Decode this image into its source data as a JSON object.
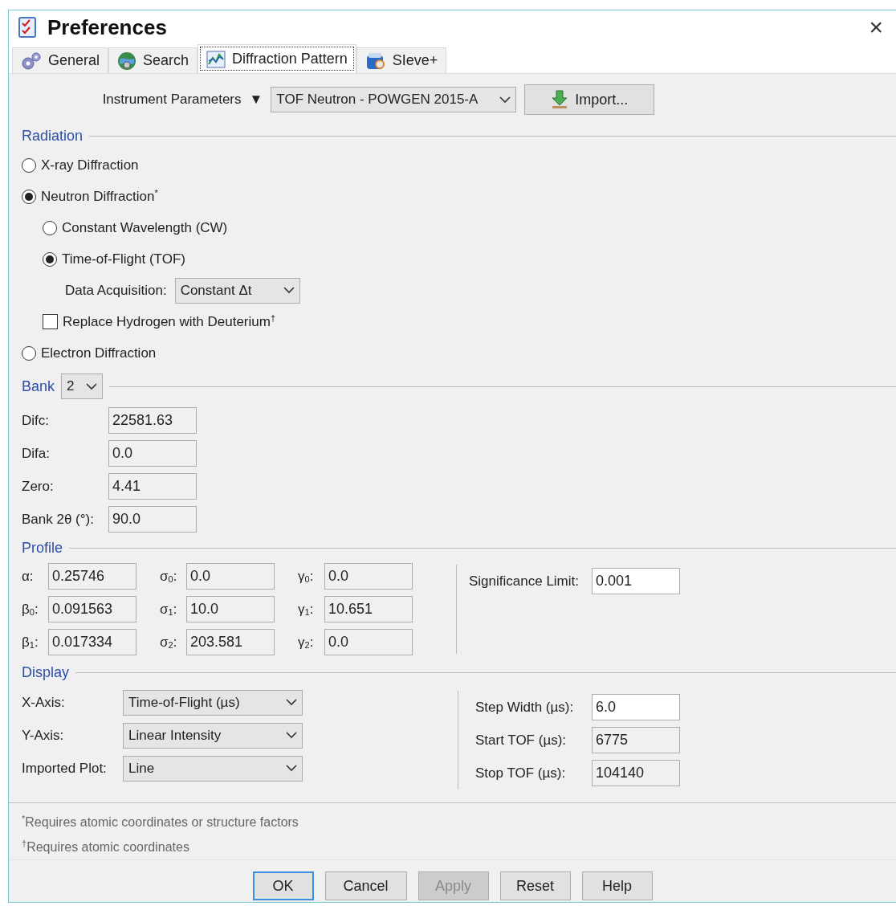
{
  "window": {
    "title": "Preferences",
    "close": "×"
  },
  "tabs": [
    {
      "label": "General",
      "selected": false
    },
    {
      "label": "Search",
      "selected": false
    },
    {
      "label": "Diffraction Pattern",
      "selected": true
    },
    {
      "label": "SIeve+",
      "selected": false
    }
  ],
  "instrument": {
    "menu_label": "Instrument Parameters",
    "menu_arrow": "▼",
    "preset": "TOF Neutron - POWGEN 2015-A",
    "import_button": "Import..."
  },
  "radiation": {
    "title": "Radiation",
    "options": [
      {
        "kind": "radio",
        "label": "X-ray Diffraction",
        "selected": false
      },
      {
        "kind": "radio",
        "label": "Neutron Diffraction$^{*}$",
        "selected": true,
        "children": [
          {
            "kind": "radio",
            "label": "Constant Wavelength (CW)",
            "selected": false
          },
          {
            "kind": "radio",
            "label": "Time-of-Flight (TOF)",
            "selected": true
          },
          {
            "kind": "select",
            "label": "Data Acquisition:",
            "value": "Constant Δt"
          },
          {
            "kind": "checkbox",
            "label": "Replace Hydrogen with Deuterium$^{†}$",
            "checked": false
          }
        ]
      },
      {
        "kind": "radio",
        "label": "Electron Diffraction",
        "selected": false
      }
    ]
  },
  "bank": {
    "title": "Bank",
    "value": "2",
    "fields": [
      {
        "label": "Difc:",
        "value": "22581.63",
        "editable": false
      },
      {
        "label": "Difa:",
        "value": "0.0",
        "editable": false
      },
      {
        "label": "Zero:",
        "value": "4.41",
        "editable": false
      },
      {
        "label": "Bank 2θ (°):",
        "value": "90.0",
        "editable": false
      }
    ]
  },
  "profile": {
    "title": "Profile",
    "columns": [
      [
        {
          "label": "α:",
          "value": "0.25746",
          "editable": false
        },
        {
          "label": "β$_{0}$:",
          "value": "0.091563",
          "editable": false
        },
        {
          "label": "β$_{1}$:",
          "value": "0.017334",
          "editable": false
        }
      ],
      [
        {
          "label": "σ$_{0}$:",
          "value": "0.0",
          "editable": false
        },
        {
          "label": "σ$_{1}$:",
          "value": "10.0",
          "editable": false
        },
        {
          "label": "σ$_{2}$:",
          "value": "203.581",
          "editable": false
        }
      ],
      [
        {
          "label": "γ$_{0}$:",
          "value": "0.0",
          "editable": false
        },
        {
          "label": "γ$_{1}$:",
          "value": "10.651",
          "editable": false
        },
        {
          "label": "γ$_{2}$:",
          "value": "0.0",
          "editable": false
        }
      ]
    ],
    "side": [
      {
        "label": "Significance Limit:",
        "value": "0.001",
        "editable": true
      }
    ]
  },
  "display": {
    "title": "Display",
    "selects": [
      {
        "label": "X-Axis:",
        "value": "Time-of-Flight (µs)"
      },
      {
        "label": "Y-Axis:",
        "value": "Linear Intensity"
      },
      {
        "label": "Imported Plot:",
        "value": "Line"
      }
    ],
    "side": [
      {
        "label": "Step Width (µs):",
        "value": "6.0",
        "editable": true
      },
      {
        "label": "Start TOF (µs):",
        "value": "6775",
        "editable": false
      },
      {
        "label": "Stop TOF (µs):",
        "value": "104140",
        "editable": false
      }
    ]
  },
  "footnotes": [
    "$^{*}$Requires atomic coordinates or structure factors",
    "$^{†}$Requires atomic coordinates"
  ],
  "buttons": [
    {
      "label": "OK",
      "default": true,
      "disabled": false
    },
    {
      "label": "Cancel",
      "default": false,
      "disabled": false
    },
    {
      "label": "Apply",
      "default": false,
      "disabled": true
    },
    {
      "label": "Reset",
      "default": false,
      "disabled": false
    },
    {
      "label": "Help",
      "default": false,
      "disabled": false
    }
  ]
}
